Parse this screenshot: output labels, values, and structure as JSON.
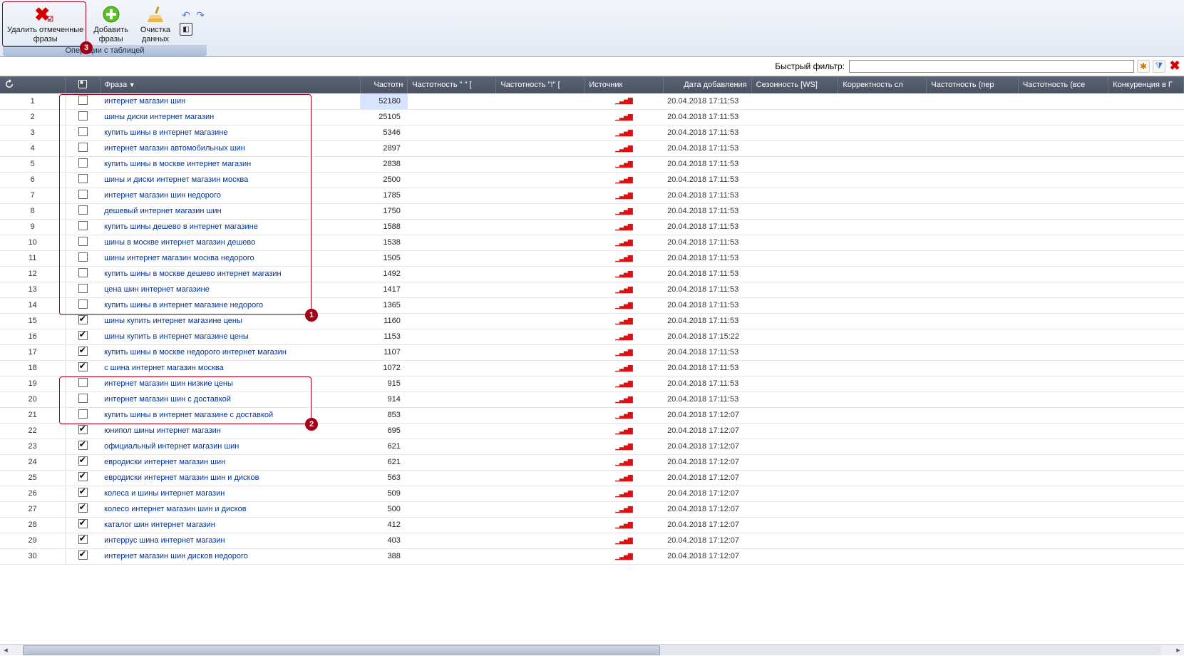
{
  "toolbar": {
    "delete": {
      "label": "Удалить отмеченные\nфразы"
    },
    "add": {
      "label": "Добавить\nфразы"
    },
    "clean": {
      "label": "Очистка\nданных",
      "dropdown": true
    },
    "undo": {
      "title": "↶"
    },
    "redo": {
      "title": "↷"
    },
    "extra": {
      "title": "▣"
    },
    "group_title": "Операции с таблицей"
  },
  "filter": {
    "label": "Быстрый фильтр:",
    "value": "",
    "placeholder": ""
  },
  "columns": {
    "rownum": "",
    "checkbox": "",
    "phrase": "Фраза",
    "freq": "Частотн",
    "freq2": "Частотность \" \" [",
    "freq3": "Частотность \"!\" [",
    "source": "Источник",
    "date": "Дата добавления",
    "season": "Сезонность [WS]",
    "correct": "Корректность сл",
    "freq_per": "Частотность (пер",
    "freq_all": "Частотность (все",
    "compete": "Конкуренция в Г"
  },
  "annotations": {
    "box1": "1",
    "box2": "2",
    "box3": "3"
  },
  "rows": [
    {
      "n": 1,
      "chk": false,
      "phrase": "интернет магазин шин",
      "freq": 52180,
      "date": "20.04.2018 17:11:53"
    },
    {
      "n": 2,
      "chk": false,
      "phrase": "шины диски интернет магазин",
      "freq": 25105,
      "date": "20.04.2018 17:11:53"
    },
    {
      "n": 3,
      "chk": false,
      "phrase": "купить шины в интернет магазине",
      "freq": 5346,
      "date": "20.04.2018 17:11:53"
    },
    {
      "n": 4,
      "chk": false,
      "phrase": "интернет магазин автомобильных шин",
      "freq": 2897,
      "date": "20.04.2018 17:11:53"
    },
    {
      "n": 5,
      "chk": false,
      "phrase": "купить шины в москве интернет магазин",
      "freq": 2838,
      "date": "20.04.2018 17:11:53"
    },
    {
      "n": 6,
      "chk": false,
      "phrase": "шины и диски интернет магазин москва",
      "freq": 2500,
      "date": "20.04.2018 17:11:53"
    },
    {
      "n": 7,
      "chk": false,
      "phrase": "интернет магазин шин недорого",
      "freq": 1785,
      "date": "20.04.2018 17:11:53"
    },
    {
      "n": 8,
      "chk": false,
      "phrase": "дешевый интернет магазин шин",
      "freq": 1750,
      "date": "20.04.2018 17:11:53"
    },
    {
      "n": 9,
      "chk": false,
      "phrase": "купить шины дешево в интернет магазине",
      "freq": 1588,
      "date": "20.04.2018 17:11:53"
    },
    {
      "n": 10,
      "chk": false,
      "phrase": "шины в москве интернет магазин дешево",
      "freq": 1538,
      "date": "20.04.2018 17:11:53"
    },
    {
      "n": 11,
      "chk": false,
      "phrase": "шины интернет магазин москва недорого",
      "freq": 1505,
      "date": "20.04.2018 17:11:53"
    },
    {
      "n": 12,
      "chk": false,
      "phrase": "купить шины в москве дешево интернет магазин",
      "freq": 1492,
      "date": "20.04.2018 17:11:53"
    },
    {
      "n": 13,
      "chk": false,
      "phrase": "цена шин интернет магазине",
      "freq": 1417,
      "date": "20.04.2018 17:11:53"
    },
    {
      "n": 14,
      "chk": false,
      "phrase": "купить шины в интернет магазине недорого",
      "freq": 1365,
      "date": "20.04.2018 17:11:53"
    },
    {
      "n": 15,
      "chk": true,
      "phrase": "шины купить интернет магазине цены",
      "freq": 1160,
      "date": "20.04.2018 17:11:53"
    },
    {
      "n": 16,
      "chk": true,
      "phrase": "шины купить в интернет магазине цены",
      "freq": 1153,
      "date": "20.04.2018 17:15:22"
    },
    {
      "n": 17,
      "chk": true,
      "phrase": "купить шины в москве недорого интернет магазин",
      "freq": 1107,
      "date": "20.04.2018 17:11:53"
    },
    {
      "n": 18,
      "chk": true,
      "phrase": "с шина интернет магазин москва",
      "freq": 1072,
      "date": "20.04.2018 17:11:53"
    },
    {
      "n": 19,
      "chk": false,
      "phrase": "интернет магазин шин низкие цены",
      "freq": 915,
      "date": "20.04.2018 17:11:53"
    },
    {
      "n": 20,
      "chk": false,
      "phrase": "интернет магазин шин с доставкой",
      "freq": 914,
      "date": "20.04.2018 17:11:53"
    },
    {
      "n": 21,
      "chk": false,
      "phrase": "купить шины в интернет магазине с доставкой",
      "freq": 853,
      "date": "20.04.2018 17:12:07"
    },
    {
      "n": 22,
      "chk": true,
      "phrase": "юнипол шины интернет магазин",
      "freq": 695,
      "date": "20.04.2018 17:12:07"
    },
    {
      "n": 23,
      "chk": true,
      "phrase": "официальный интернет магазин шин",
      "freq": 621,
      "date": "20.04.2018 17:12:07"
    },
    {
      "n": 24,
      "chk": true,
      "phrase": "евродиски интернет магазин шин",
      "freq": 621,
      "date": "20.04.2018 17:12:07"
    },
    {
      "n": 25,
      "chk": true,
      "phrase": "евродиски интернет магазин шин и дисков",
      "freq": 563,
      "date": "20.04.2018 17:12:07"
    },
    {
      "n": 26,
      "chk": true,
      "phrase": "колеса и шины интернет магазин",
      "freq": 509,
      "date": "20.04.2018 17:12:07"
    },
    {
      "n": 27,
      "chk": true,
      "phrase": "колесо интернет магазин шин и дисков",
      "freq": 500,
      "date": "20.04.2018 17:12:07"
    },
    {
      "n": 28,
      "chk": true,
      "phrase": "каталог шин интернет магазин",
      "freq": 412,
      "date": "20.04.2018 17:12:07"
    },
    {
      "n": 29,
      "chk": true,
      "phrase": "интеррус шина интернет магазин",
      "freq": 403,
      "date": "20.04.2018 17:12:07"
    },
    {
      "n": 30,
      "chk": true,
      "phrase": "интернет магазин шин дисков недорого",
      "freq": 388,
      "date": "20.04.2018 17:12:07"
    }
  ]
}
